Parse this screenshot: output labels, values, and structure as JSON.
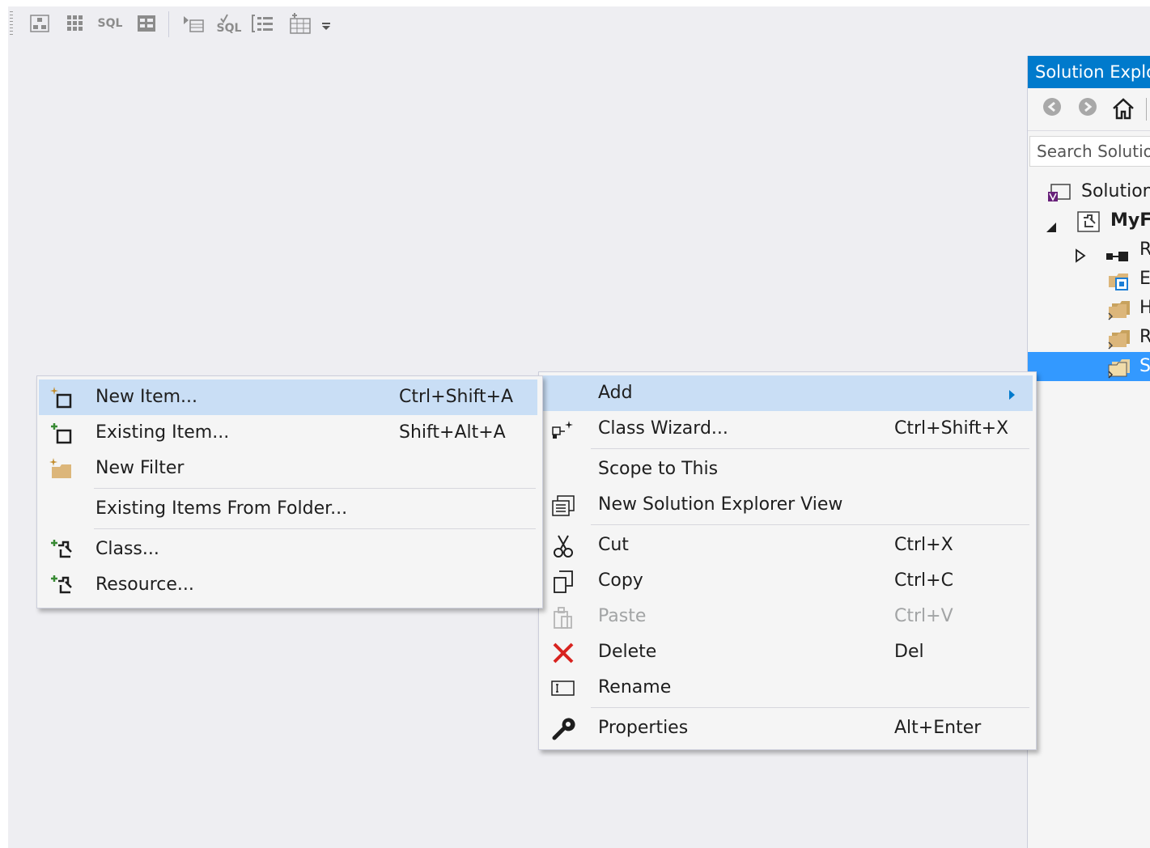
{
  "toolbar": {
    "sql1": "SQL",
    "sql2": "SQL"
  },
  "solution_explorer": {
    "title": "Solution Explorer",
    "search_placeholder": "Search Solution Explorer",
    "tree": [
      {
        "label": "Solution"
      },
      {
        "label": "MyFi"
      },
      {
        "label": "R"
      },
      {
        "label": "E"
      },
      {
        "label": "H"
      },
      {
        "label": "R"
      },
      {
        "label": "S"
      }
    ]
  },
  "main_menu": {
    "items": [
      {
        "label": "Add"
      },
      {
        "label": "Class Wizard...",
        "shortcut": "Ctrl+Shift+X"
      },
      {
        "label": "Scope to This"
      },
      {
        "label": "New Solution Explorer View"
      },
      {
        "label": "Cut",
        "shortcut": "Ctrl+X"
      },
      {
        "label": "Copy",
        "shortcut": "Ctrl+C"
      },
      {
        "label": "Paste",
        "shortcut": "Ctrl+V"
      },
      {
        "label": "Delete",
        "shortcut": "Del"
      },
      {
        "label": "Rename"
      },
      {
        "label": "Properties",
        "shortcut": "Alt+Enter"
      }
    ]
  },
  "add_submenu": {
    "items": [
      {
        "label": "New Item...",
        "shortcut": "Ctrl+Shift+A"
      },
      {
        "label": "Existing Item...",
        "shortcut": "Shift+Alt+A"
      },
      {
        "label": "New Filter"
      },
      {
        "label": "Existing Items From Folder..."
      },
      {
        "label": "Class..."
      },
      {
        "label": "Resource..."
      }
    ]
  },
  "colors": {
    "accent": "#007acc",
    "highlight": "#c9def5",
    "selection": "#3399ff",
    "delete_red": "#d8231f"
  }
}
